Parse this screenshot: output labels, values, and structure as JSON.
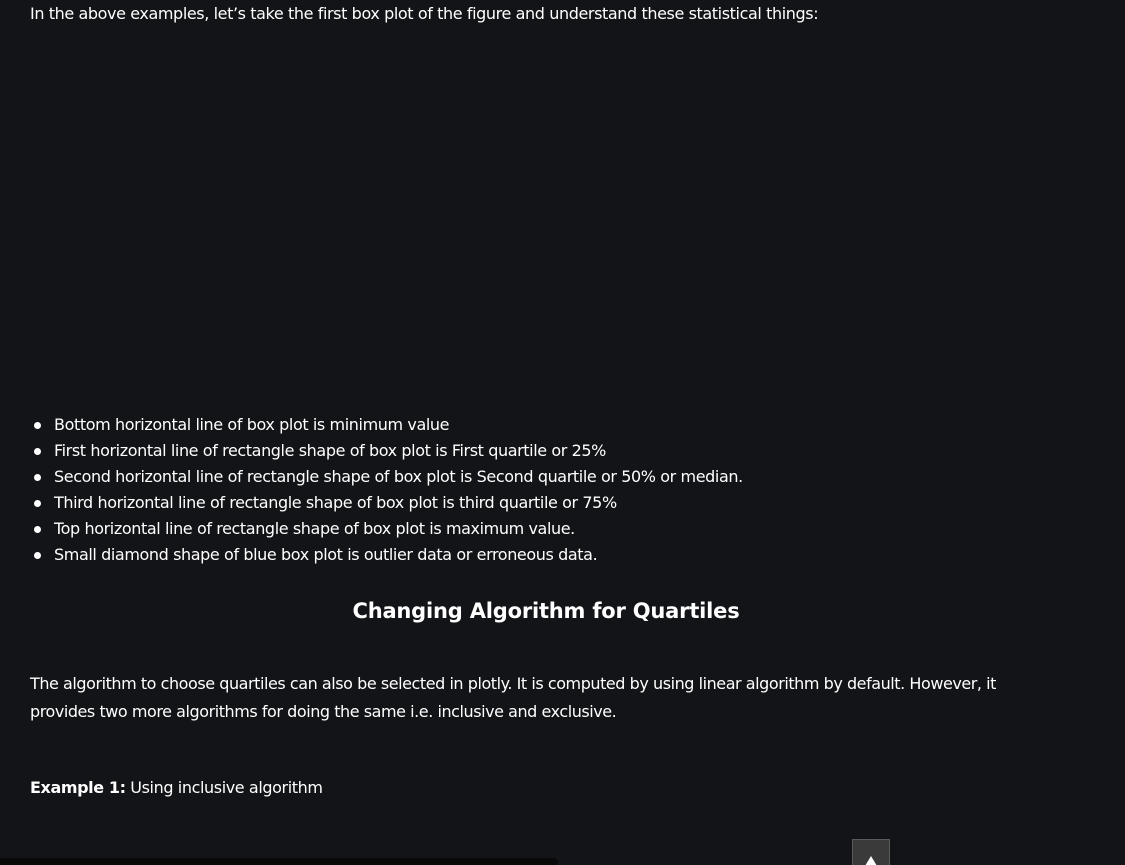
{
  "article": {
    "intro": "In the above examples, let’s take the first box plot of the figure and understand these statistical things:",
    "bullets": [
      "Bottom horizontal line of box plot is minimum value",
      "First horizontal line of rectangle shape of box plot is First quartile or 25%",
      "Second horizontal line of rectangle shape of box plot is Second quartile or 50% or median.",
      "Third horizontal line of rectangle shape of box plot is third quartile or 75%",
      "Top horizontal line of rectangle shape of box plot is maximum value.",
      "Small diamond shape of blue box plot is outlier data or erroneous data."
    ],
    "section_heading": "Changing Algorithm for Quartiles",
    "paragraph": "The algorithm to choose quartiles can also be selected in plotly. It is computed by using linear algorithm by default. However, it provides two more algorithms for doing the same i.e. inclusive and exclusive.",
    "example": {
      "label": "Example 1:",
      "text": " Using inclusive algorithm"
    }
  },
  "controls": {
    "scroll_top_icon": "arrow-up-icon"
  },
  "colors": {
    "background": "#131417",
    "text": "#ffffff",
    "scroll_button": "#3a3a3a"
  }
}
